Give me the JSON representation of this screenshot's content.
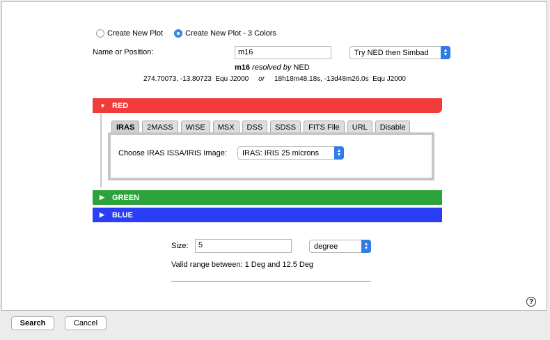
{
  "plot_mode": {
    "option_single": "Create New Plot",
    "option_three": "Create New Plot - 3 Colors",
    "selected": "option_three"
  },
  "position": {
    "label": "Name or Position:",
    "value": "m16",
    "resolver": "Try NED then Simbad",
    "resolved_name": "m16",
    "resolved_by_text": "resolved by",
    "resolved_service": "NED",
    "coord_decimal": "274.70073, -13.80723  Equ J2000",
    "or_text": "or",
    "coord_sexagesimal": "18h18m48.18s, -13d48m26.0s  Equ J2000"
  },
  "bands": {
    "red": "RED",
    "green": "GREEN",
    "blue": "BLUE"
  },
  "tabs": [
    "IRAS",
    "2MASS",
    "WISE",
    "MSX",
    "DSS",
    "SDSS",
    "FITS File",
    "URL",
    "Disable"
  ],
  "active_tab": "IRAS",
  "iras": {
    "label": "Choose IRAS ISSA/IRIS Image:",
    "selected": "IRAS: IRIS 25 microns"
  },
  "size": {
    "label": "Size:",
    "value": "5",
    "unit": "degree",
    "valid_range": "Valid range between: 1 Deg and 12.5 Deg"
  },
  "buttons": {
    "search": "Search",
    "cancel": "Cancel"
  },
  "help_icon": "?",
  "colors": {
    "red": "#f23b3b",
    "green": "#2ca33a",
    "blue": "#2a3ff5",
    "accent": "#2f7ce6"
  }
}
